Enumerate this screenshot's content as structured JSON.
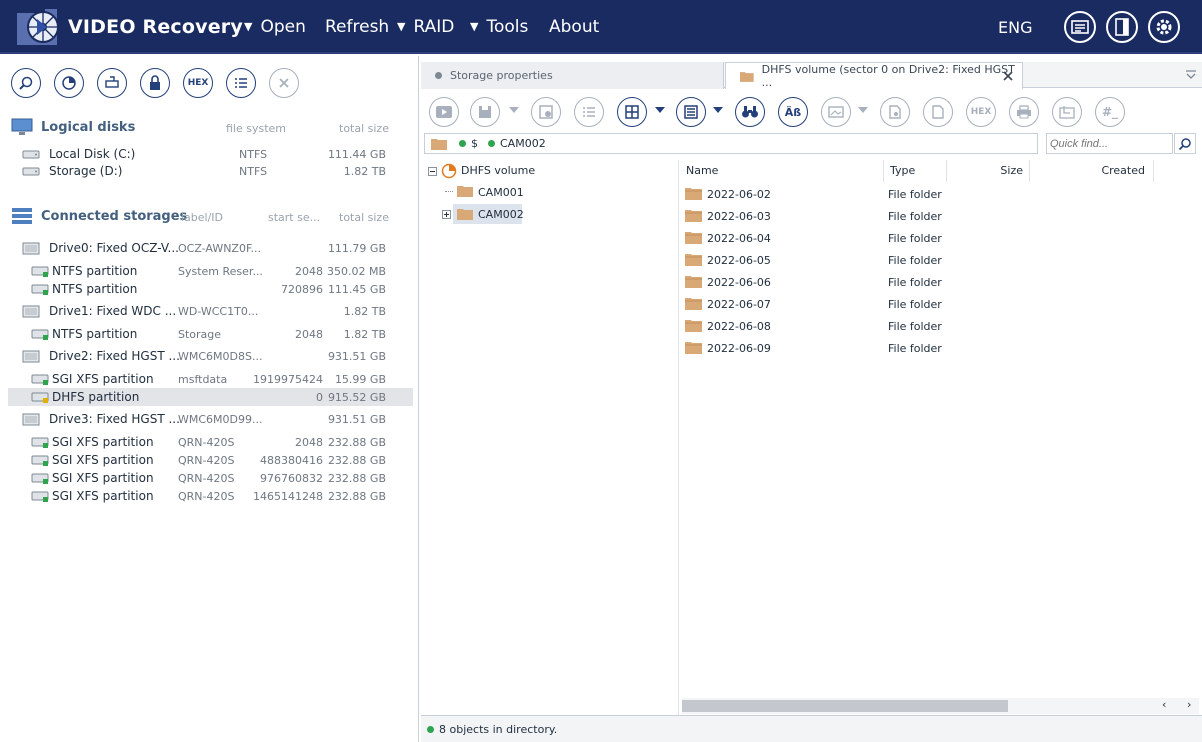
{
  "app": {
    "title": "VIDEO Recovery",
    "menu": [
      "Open",
      "Refresh",
      "RAID",
      "Tools",
      "About"
    ],
    "language": "ENG"
  },
  "left": {
    "logical_disks": {
      "title": "Logical disks",
      "col_fs": "file system",
      "col_size": "total size",
      "items": [
        {
          "name": "Local Disk (C:)",
          "fs": "NTFS",
          "size": "111.44 GB"
        },
        {
          "name": "Storage (D:)",
          "fs": "NTFS",
          "size": "1.82 TB"
        }
      ]
    },
    "connected": {
      "title": "Connected storages",
      "col_label": "label/ID",
      "col_start": "start se...",
      "col_size": "total size",
      "rows": [
        {
          "name": "Drive0: Fixed OCZ-V...",
          "label": "OCZ-AWNZ0F...",
          "start": "",
          "size": "111.79 GB",
          "drive": true
        },
        {
          "name": "NTFS partition",
          "label": "System Reser...",
          "start": "2048",
          "size": "350.02 MB",
          "drive": false
        },
        {
          "name": "NTFS partition",
          "label": "",
          "start": "720896",
          "size": "111.45 GB",
          "drive": false
        },
        {
          "name": "Drive1: Fixed WDC ...",
          "label": "WD-WCC1T0...",
          "start": "",
          "size": "1.82 TB",
          "drive": true
        },
        {
          "name": "NTFS partition",
          "label": "Storage",
          "start": "2048",
          "size": "1.82 TB",
          "drive": false
        },
        {
          "name": "Drive2: Fixed HGST ...",
          "label": "WMC6M0D8S...",
          "start": "",
          "size": "931.51 GB",
          "drive": true
        },
        {
          "name": "SGI XFS partition",
          "label": "msftdata",
          "start": "1919975424",
          "size": "15.99 GB",
          "drive": false
        },
        {
          "name": "DHFS partition",
          "label": "",
          "start": "0",
          "size": "915.52 GB",
          "drive": false,
          "selected": true
        },
        {
          "name": "Drive3: Fixed HGST ...",
          "label": "WMC6M0D99...",
          "start": "",
          "size": "931.51 GB",
          "drive": true
        },
        {
          "name": "SGI XFS partition",
          "label": "QRN-420S",
          "start": "2048",
          "size": "232.88 GB",
          "drive": false
        },
        {
          "name": "SGI XFS partition",
          "label": "QRN-420S",
          "start": "488380416",
          "size": "232.88 GB",
          "drive": false
        },
        {
          "name": "SGI XFS partition",
          "label": "QRN-420S",
          "start": "976760832",
          "size": "232.88 GB",
          "drive": false
        },
        {
          "name": "SGI XFS partition",
          "label": "QRN-420S",
          "start": "1465141248",
          "size": "232.88 GB",
          "drive": false
        }
      ]
    }
  },
  "right": {
    "tabs": [
      {
        "label": "Storage properties"
      },
      {
        "label": "DHFS volume (sector 0 on Drive2: Fixed HGST ..."
      }
    ],
    "path": [
      "$",
      "CAM002"
    ],
    "quick_find_placeholder": "Quick find...",
    "tree": {
      "root": "DHFS volume",
      "children": [
        "CAM001",
        "CAM002"
      ]
    },
    "columns": [
      "Name",
      "Type",
      "Size",
      "Created"
    ],
    "files": [
      {
        "name": "2022-06-02",
        "type": "File folder"
      },
      {
        "name": "2022-06-03",
        "type": "File folder"
      },
      {
        "name": "2022-06-04",
        "type": "File folder"
      },
      {
        "name": "2022-06-05",
        "type": "File folder"
      },
      {
        "name": "2022-06-06",
        "type": "File folder"
      },
      {
        "name": "2022-06-07",
        "type": "File folder"
      },
      {
        "name": "2022-06-08",
        "type": "File folder"
      },
      {
        "name": "2022-06-09",
        "type": "File folder"
      }
    ],
    "status": "8 objects in directory."
  },
  "colors": {
    "topbar": "#1a2b61",
    "accent": "#24407a",
    "folder": "#d9a877",
    "status_ok": "#2ea44f",
    "selected_row": "#e2e4e8"
  }
}
